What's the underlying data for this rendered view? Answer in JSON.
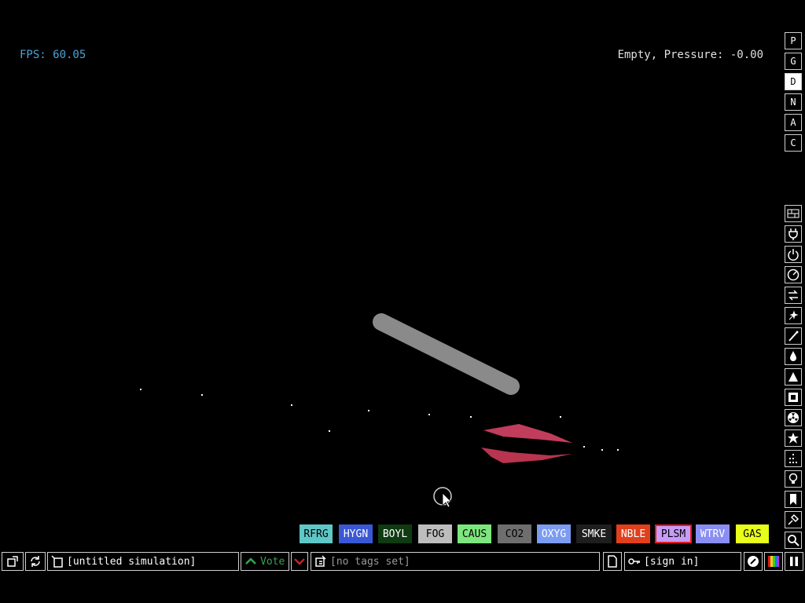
{
  "hud": {
    "fps_text": "FPS: 60.05",
    "status_text": "Empty, Pressure: -0.00"
  },
  "mode_buttons": [
    "P",
    "G",
    "D",
    "N",
    "A",
    "C"
  ],
  "active_mode": "D",
  "elements": [
    {
      "label": "RFRG",
      "bg": "#5fc7c7",
      "fg": "#000000"
    },
    {
      "label": "HYGN",
      "bg": "#3a58d6",
      "fg": "#ffffff"
    },
    {
      "label": "BOYL",
      "bg": "#0f3a12",
      "fg": "#ffffff"
    },
    {
      "label": "FOG",
      "bg": "#bdbdbd",
      "fg": "#000000"
    },
    {
      "label": "CAUS",
      "bg": "#7ee67e",
      "fg": "#000000"
    },
    {
      "label": "CO2",
      "bg": "#6e6e6e",
      "fg": "#000000"
    },
    {
      "label": "OXYG",
      "bg": "#7c9cf2",
      "fg": "#ffffff"
    },
    {
      "label": "SMKE",
      "bg": "#1e1e1e",
      "fg": "#ffffff"
    },
    {
      "label": "NBLE",
      "bg": "#e0401c",
      "fg": "#ffffff"
    },
    {
      "label": "PLSM",
      "bg": "#c79cf7",
      "fg": "#000000"
    },
    {
      "label": "WTRV",
      "bg": "#8a8ef2",
      "fg": "#ffffff"
    },
    {
      "label": "GAS",
      "bg": "#e8ff1a",
      "fg": "#000000"
    }
  ],
  "selected_element": "PLSM",
  "bottom_bar": {
    "sim_title": "[untitled simulation]",
    "vote_label": "Vote",
    "tags_text": "[no tags set]",
    "sign_in": "[sign in]"
  },
  "category_icons": [
    "walls-icon",
    "electronics-icon",
    "powered-icon",
    "sensors-icon",
    "force-icon",
    "explosives-icon",
    "gases-icon",
    "liquids-icon",
    "powders-icon",
    "solids-icon",
    "radioactive-icon",
    "special-icon",
    "life-icon",
    "tools-icon",
    "favorites-icon",
    "decoration-icon",
    "search-icon"
  ],
  "colors": {
    "accent_fps": "#4aa3d8",
    "selection_border": "#e41c1c",
    "vote_green": "#2fa84f",
    "vote_red": "#c02424",
    "gas_grey": "#8a8a8a",
    "plasma_red": "#c23c5c"
  }
}
